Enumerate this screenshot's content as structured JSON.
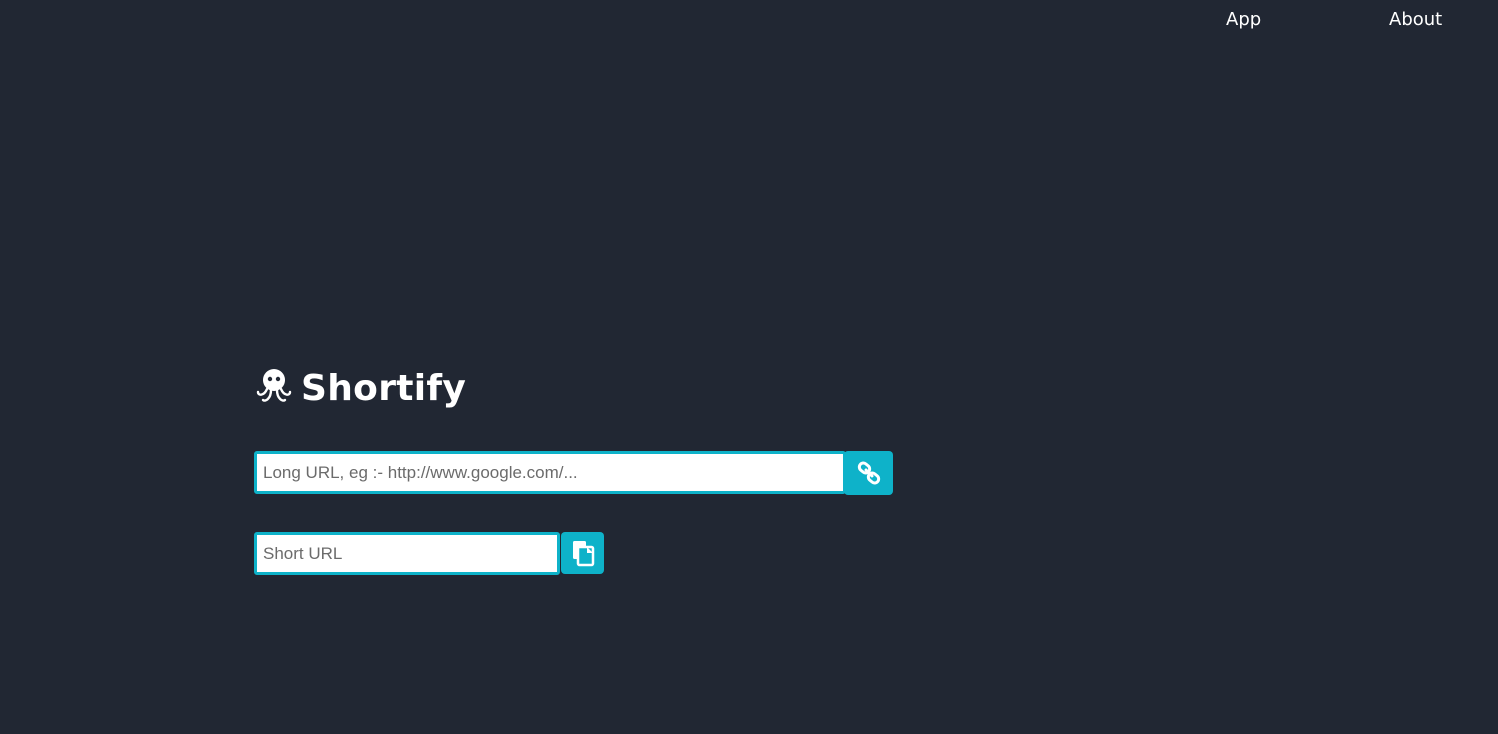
{
  "nav": {
    "items": [
      {
        "label": "App"
      },
      {
        "label": "About"
      }
    ]
  },
  "brand": {
    "name": "Shortify",
    "logo_icon": "octopus-icon"
  },
  "form": {
    "long_url": {
      "placeholder": "Long URL, eg :- http://www.google.com/...",
      "value": ""
    },
    "shorten_button": {
      "icon": "link-icon"
    },
    "short_url": {
      "placeholder": "Short URL",
      "value": ""
    },
    "copy_button": {
      "icon": "copy-icon"
    }
  },
  "colors": {
    "background": "#212733",
    "accent": "#0eb2c9",
    "text": "#ffffff"
  }
}
